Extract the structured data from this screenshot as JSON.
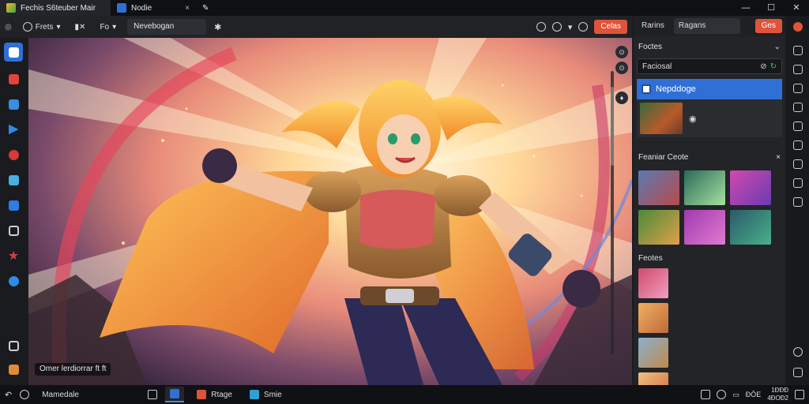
{
  "window": {
    "tabs": [
      {
        "label": "Fechis S6teuber Mair",
        "close": "×"
      },
      {
        "label": "Nodie",
        "close": "×"
      }
    ],
    "controls": {
      "minimize": "—",
      "maximize": "☐",
      "close": "✕"
    }
  },
  "toolbar": {
    "tool1_label": "Frets",
    "tool2_label": "Fo",
    "field_value": "Nevebogan",
    "action_button": "Celas"
  },
  "canvas": {
    "caption": "Omer lerdiorrar ft ft",
    "float_icons": [
      "⊙",
      "⊙",
      "♦"
    ]
  },
  "right_panel": {
    "tabs": [
      "Rarins",
      "Ragans"
    ],
    "action_button": "Ges",
    "section1_title": "Foctes",
    "search_value": "Faciosal",
    "selected_item": "Nepddoge",
    "section2_title": "Feaniar Ceote",
    "section3_title": "Feotes"
  },
  "taskbar": {
    "search_label": "Mamedale",
    "item1_label": "Rtage",
    "item2_label": "Smie",
    "tray_text": "ĐŌE",
    "clock_time": "1ĐĐĐ",
    "clock_date": "4ĐOĐ2"
  },
  "colors": {
    "accent_blue": "#2f6fd6",
    "accent_orange": "#e0533b",
    "background": "#1b1c1f"
  }
}
